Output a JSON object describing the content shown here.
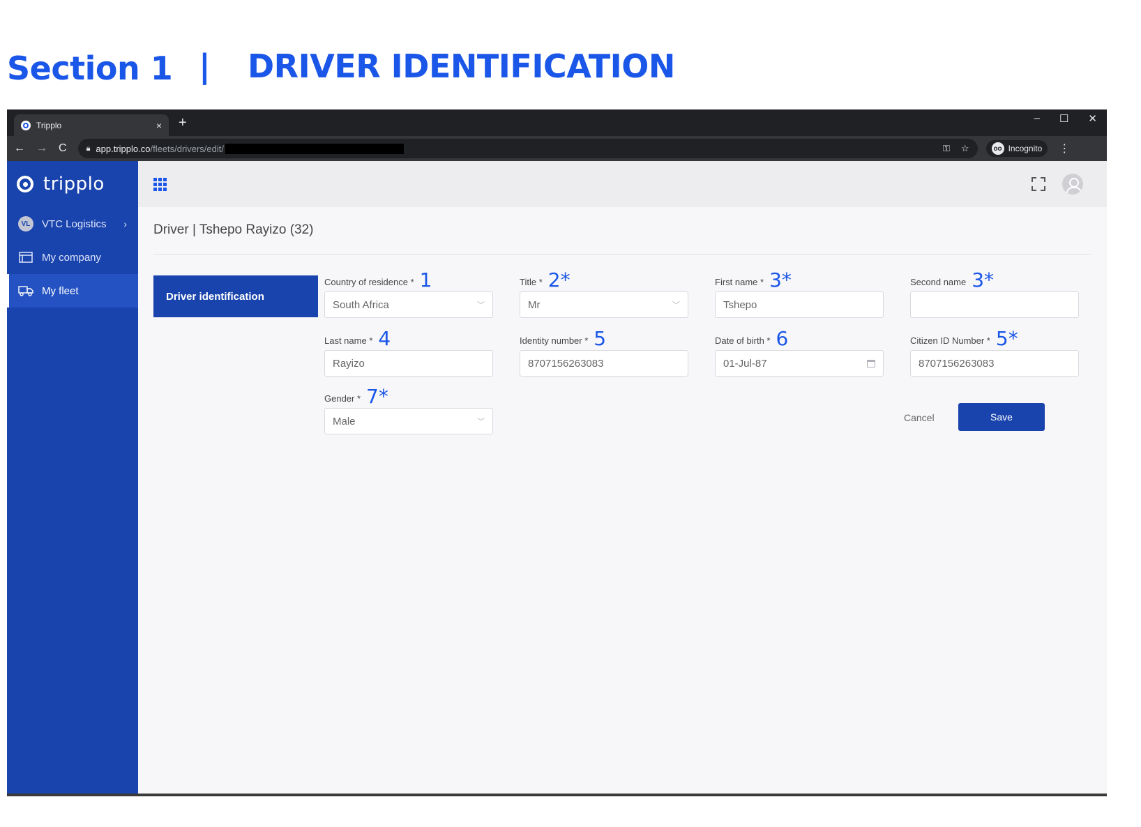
{
  "heading": {
    "section": "Section 1",
    "separator": "|",
    "title": "DRIVER IDENTIFICATION"
  },
  "browser": {
    "tab_title": "Tripplo",
    "tab_close": "×",
    "new_tab": "+",
    "window_controls": [
      "–",
      "☐",
      "✕"
    ],
    "nav": {
      "back": "←",
      "forward": "→",
      "reload": "C"
    },
    "url_domain": "app.tripplo.co",
    "url_path": "/fleets/drivers/edit/",
    "incognito_label": "Incognito",
    "menu": "⋮"
  },
  "sidebar": {
    "brand": "tripplo",
    "org": {
      "initials": "VL",
      "label": "VTC Logistics",
      "chevron": "›"
    },
    "items": [
      {
        "label": "My company",
        "icon": "company-icon"
      },
      {
        "label": "My fleet",
        "icon": "truck-icon",
        "active": true
      }
    ]
  },
  "main": {
    "page_title": "Driver | Tshepo Rayizo (32)",
    "section_tab": "Driver identification"
  },
  "form": {
    "country": {
      "label": "Country of residence *",
      "annotation": "1",
      "value": "South Africa"
    },
    "title": {
      "label": "Title *",
      "annotation": "2*",
      "value": "Mr"
    },
    "first_name": {
      "label": "First name *",
      "annotation": "3*",
      "value": "Tshepo"
    },
    "second_name": {
      "label": "Second name",
      "annotation": "3*",
      "value": ""
    },
    "last_name": {
      "label": "Last name *",
      "annotation": "4",
      "value": "Rayizo"
    },
    "identity_number": {
      "label": "Identity number *",
      "annotation": "5",
      "value": "8707156263083"
    },
    "date_of_birth": {
      "label": "Date of birth *",
      "annotation": "6",
      "value": "01-Jul-87"
    },
    "citizen_id": {
      "label": "Citizen ID Number *",
      "annotation": "5*",
      "value": "8707156263083"
    },
    "gender": {
      "label": "Gender *",
      "annotation": "7*",
      "value": "Male"
    }
  },
  "actions": {
    "cancel": "Cancel",
    "save": "Save"
  },
  "colors": {
    "brand": "#1a44ad",
    "annotation": "#1a56e8",
    "chrome": "#202124"
  }
}
